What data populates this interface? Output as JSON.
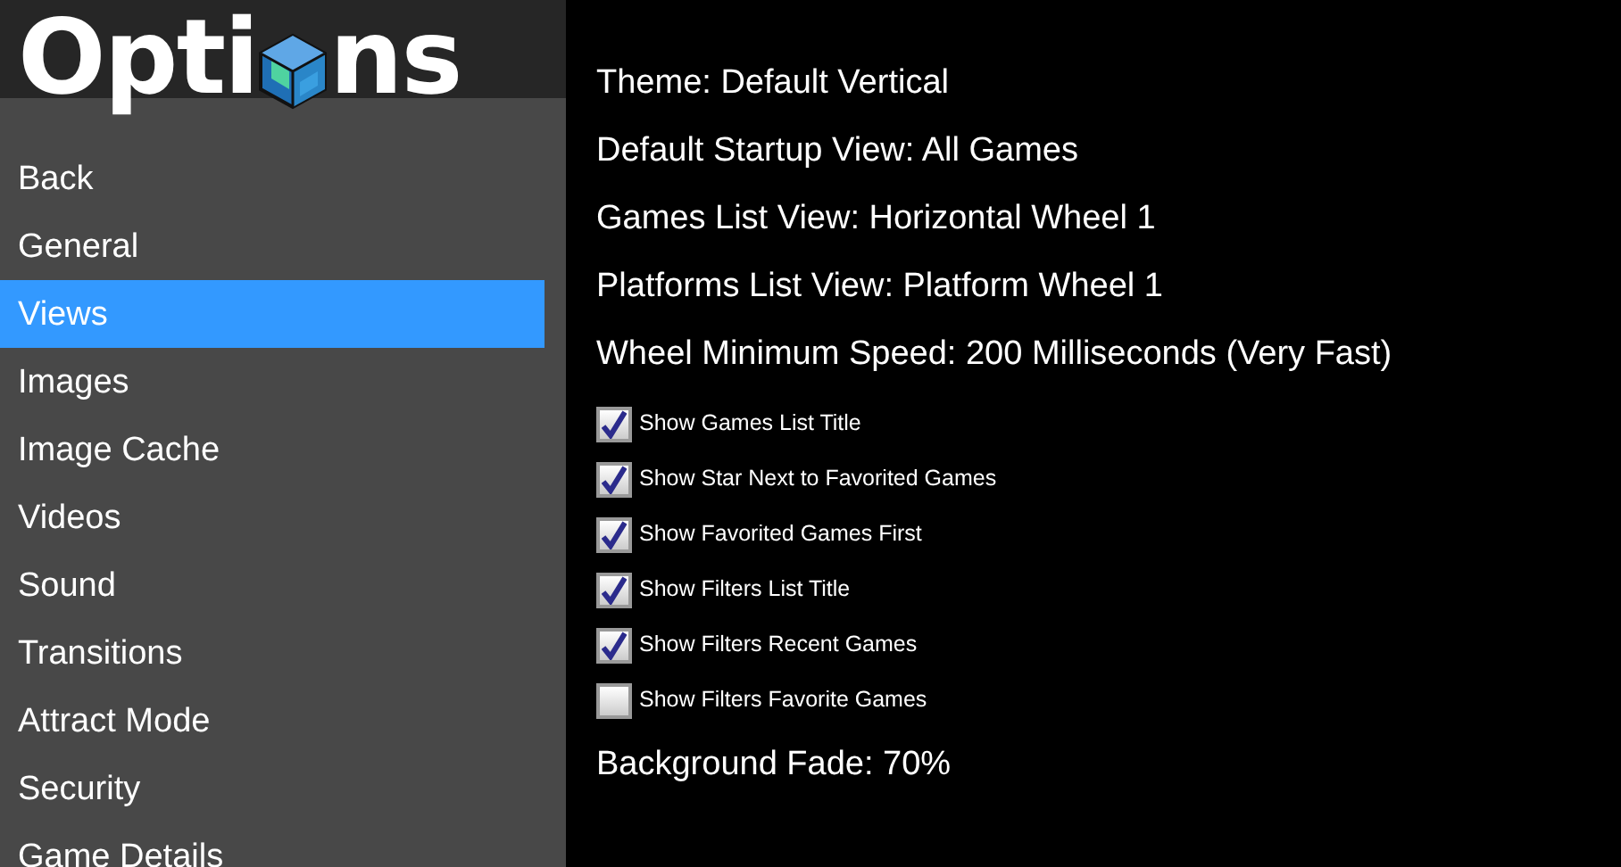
{
  "header": {
    "title_before": "Opti",
    "title_after": "ns"
  },
  "sidebar": {
    "items": [
      {
        "label": "Back",
        "selected": false
      },
      {
        "label": "General",
        "selected": false
      },
      {
        "label": "Views",
        "selected": true
      },
      {
        "label": "Images",
        "selected": false
      },
      {
        "label": "Image Cache",
        "selected": false
      },
      {
        "label": "Videos",
        "selected": false
      },
      {
        "label": "Sound",
        "selected": false
      },
      {
        "label": "Transitions",
        "selected": false
      },
      {
        "label": "Attract Mode",
        "selected": false
      },
      {
        "label": "Security",
        "selected": false
      },
      {
        "label": "Game Details",
        "selected": false
      }
    ]
  },
  "settings": [
    {
      "kind": "value",
      "label": "Theme: Default Vertical"
    },
    {
      "kind": "value",
      "label": "Default Startup View: All Games"
    },
    {
      "kind": "value",
      "label": "Games List View: Horizontal Wheel 1"
    },
    {
      "kind": "value",
      "label": "Platforms List View: Platform Wheel 1"
    },
    {
      "kind": "value",
      "label": "Wheel Minimum Speed: 200 Milliseconds (Very Fast)"
    },
    {
      "kind": "checkbox",
      "label": "Show Games List Title",
      "checked": true
    },
    {
      "kind": "checkbox",
      "label": "Show Star Next to Favorited Games",
      "checked": true
    },
    {
      "kind": "checkbox",
      "label": "Show Favorited Games First",
      "checked": true
    },
    {
      "kind": "checkbox",
      "label": "Show Filters List Title",
      "checked": true
    },
    {
      "kind": "checkbox",
      "label": "Show Filters Recent Games",
      "checked": true
    },
    {
      "kind": "checkbox",
      "label": "Show Filters Favorite Games",
      "checked": false
    },
    {
      "kind": "value",
      "label": "Background Fade: 70%"
    }
  ]
}
